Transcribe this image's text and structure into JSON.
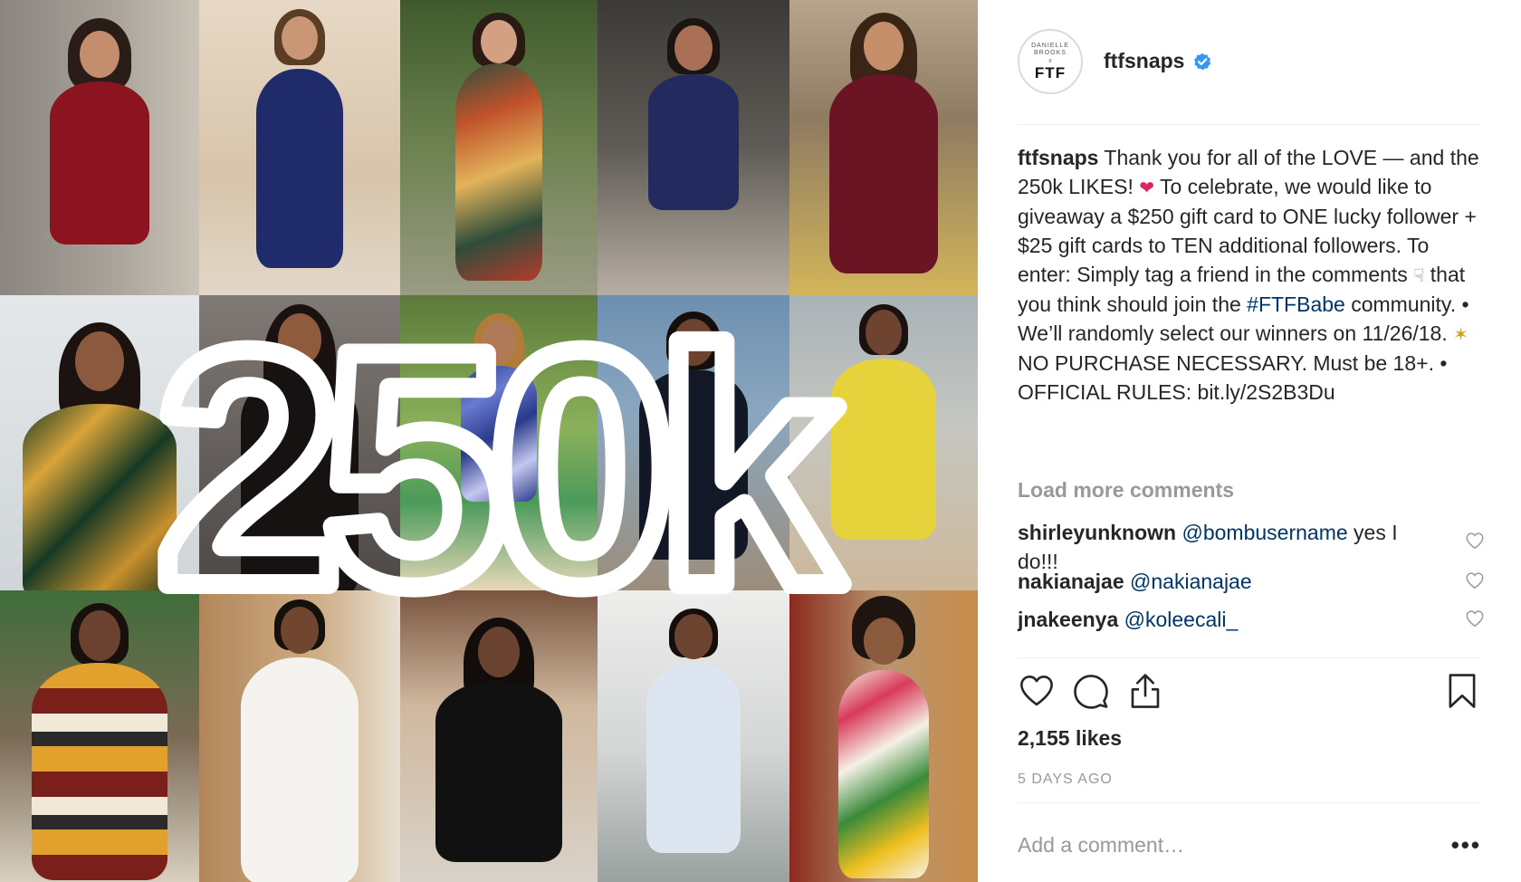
{
  "post": {
    "overlay_text": "250k"
  },
  "header": {
    "avatar_top_text": "DANIELLE BROOKS",
    "avatar_x": "x",
    "avatar_brand": "FTF",
    "username": "ftfsnaps",
    "verified_icon": "verified-badge-icon"
  },
  "caption": {
    "user": "ftfsnaps",
    "part1": " Thank you for all of the LOVE — and the 250k LIKES! ",
    "heart": "❤",
    "part2": "  To celebrate, we would like to giveaway a $250 gift card to ONE lucky follower + $25 gift cards to TEN additional followers. To enter: Simply tag a friend in the comments ",
    "pointing": "☟",
    "part3": "  that you think should join the ",
    "hashtag": "#FTFBabe",
    "part4": " community. • We’ll randomly select our winners on 11/26/18. ",
    "party": "✶",
    "part5": "  NO PURCHASE NECESSARY. Must be 18+. •",
    "part6": "OFFICIAL RULES: bit.ly/2S2B3Du"
  },
  "load_more": "Load more comments",
  "comments": [
    {
      "user": "shirleyunknown",
      "mention": "@bombusername",
      "text": " yes I do!!!"
    },
    {
      "user": "nakianajae",
      "mention": "@nakianajae",
      "text": ""
    },
    {
      "user": "jnakeenya",
      "mention": "@koleecali_",
      "text": ""
    }
  ],
  "actions": {
    "like_icon": "heart-icon",
    "comment_icon": "comment-icon",
    "share_icon": "share-icon",
    "save_icon": "bookmark-icon"
  },
  "likes": "2,155 likes",
  "timestamp": "5 DAYS AGO",
  "add_comment_placeholder": "Add a comment…",
  "more_options": "•••",
  "colors": {
    "link": "#003569",
    "muted": "#999999",
    "verified": "#3897f0",
    "text": "#262626"
  }
}
